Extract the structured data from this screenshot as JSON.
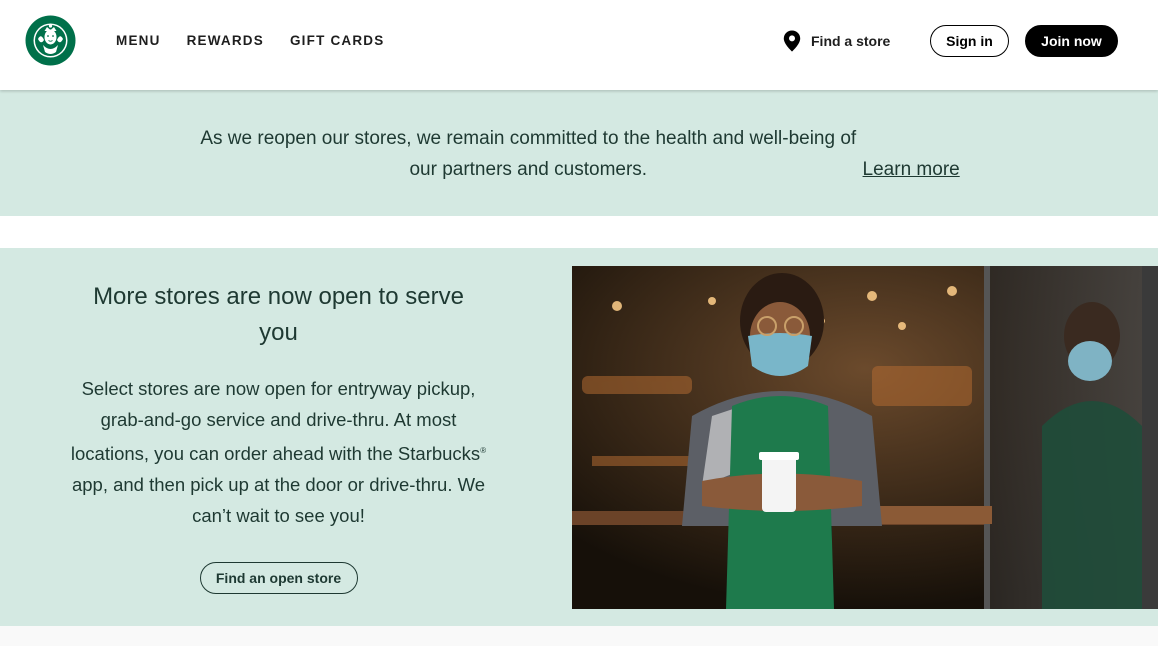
{
  "header": {
    "logo_name": "siren-logo",
    "nav": [
      {
        "label": "MENU"
      },
      {
        "label": "REWARDS"
      },
      {
        "label": "GIFT CARDS"
      }
    ],
    "find_store": "Find a store",
    "sign_in": "Sign in",
    "join_now": "Join now"
  },
  "banner": {
    "text": "As we reopen our stores, we remain committed to the health and well-being of our partners and customers.",
    "link": "Learn more"
  },
  "feature": {
    "title": "More stores are now open to serve you",
    "body_part1": "Select stores are now open for entryway pickup, grab-and-go service and drive-thru. At most locations, you can order ahead with the Starbucks",
    "registered": "®",
    "body_part2": " app, and then pick up at the door or drive-thru. We can’t wait to see you!",
    "button": "Find an open store",
    "image_alt": "barista-in-mask-photo"
  },
  "colors": {
    "brand_green": "#00704a",
    "house_green": "#1e3932",
    "mint": "#d4e9e2"
  }
}
